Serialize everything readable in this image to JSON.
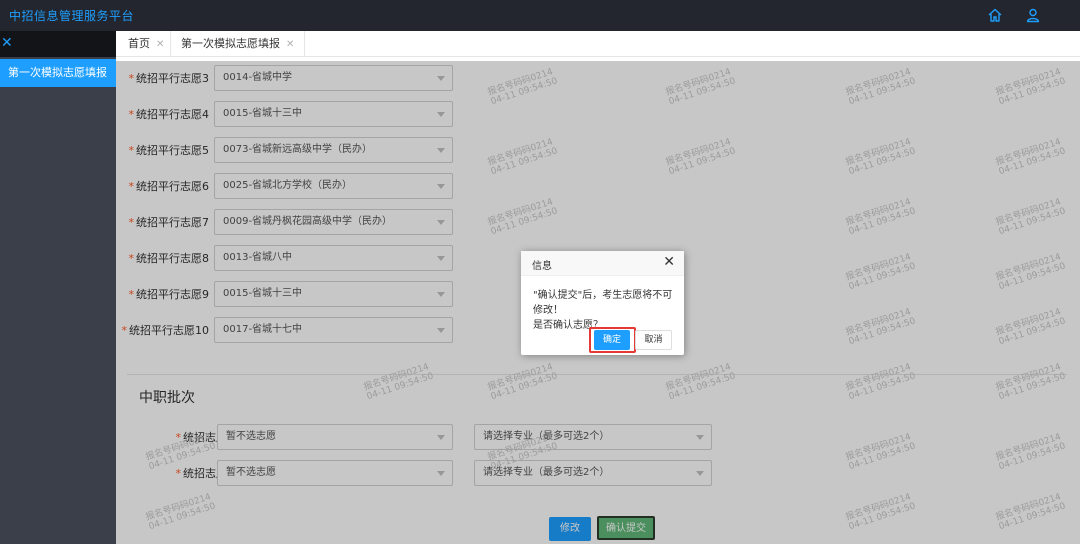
{
  "header": {
    "app_title": "中招信息管理服务平台",
    "icons": [
      "home-icon",
      "user-icon"
    ]
  },
  "sidebar": {
    "items": [
      {
        "label": "第一次模拟志愿填报"
      }
    ]
  },
  "tabs": [
    {
      "label": "首页"
    },
    {
      "label": "第一次模拟志愿填报"
    }
  ],
  "form": {
    "rows": [
      {
        "label": "统招平行志愿3",
        "value": "0014-省城中学"
      },
      {
        "label": "统招平行志愿4",
        "value": "0015-省城十三中"
      },
      {
        "label": "统招平行志愿5",
        "value": "0073-省城新远高级中学（民办）"
      },
      {
        "label": "统招平行志愿6",
        "value": "0025-省城北方学校（民办）"
      },
      {
        "label": "统招平行志愿7",
        "value": "0009-省城丹枫花园高级中学（民办）"
      },
      {
        "label": "统招平行志愿8",
        "value": "0013-省城八中"
      },
      {
        "label": "统招平行志愿9",
        "value": "0015-省城十三中"
      },
      {
        "label": "统招平行志愿10",
        "value": "0017-省城十七中"
      }
    ],
    "section_title": "中职批次",
    "vocational_rows": [
      {
        "label": "统招志愿一",
        "school": "暂不选志愿",
        "major": "请选择专业（最多可选2个）"
      },
      {
        "label": "统招志愿二",
        "school": "暂不选志愿",
        "major": "请选择专业（最多可选2个）"
      }
    ],
    "modify_label": "修改",
    "submit_label": "确认提交"
  },
  "watermark": {
    "line1": "报名号码码0214",
    "line2": "04-11 09:54:50"
  },
  "dialog": {
    "title": "信息",
    "message_line1": "\"确认提交\"后，考生志愿将不可修改！",
    "message_line2": "是否确认志愿？",
    "confirm_label": "确定",
    "cancel_label": "取消"
  },
  "colors": {
    "primary": "#1e9fff",
    "topbar": "#23262e",
    "sidebar": "#3a3f4a",
    "submit": "#5fb878",
    "highlight": "#e53935"
  }
}
